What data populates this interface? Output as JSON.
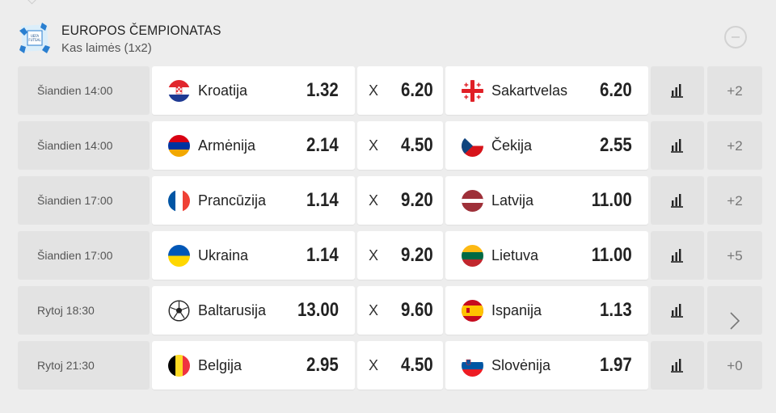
{
  "league": {
    "title": "EUROPOS ČEMPIONATAS",
    "market": "Kas laimės (1x2)",
    "logo_text": "FUTSAL"
  },
  "draw_symbol": "X",
  "matches": [
    {
      "time": "Šiandien 14:00",
      "home": "Kroatija",
      "home_flag": "croatia-flag-icon",
      "home_odd": "1.32",
      "draw_odd": "6.20",
      "away": "Sakartvelas",
      "away_flag": "georgia-flag-icon",
      "away_odd": "6.20",
      "more": "+2",
      "more_type": "count"
    },
    {
      "time": "Šiandien 14:00",
      "home": "Armėnija",
      "home_flag": "armenia-flag-icon",
      "home_odd": "2.14",
      "draw_odd": "4.50",
      "away": "Čekija",
      "away_flag": "czechia-flag-icon",
      "away_odd": "2.55",
      "more": "+2",
      "more_type": "count"
    },
    {
      "time": "Šiandien 17:00",
      "home": "Prancūzija",
      "home_flag": "france-flag-icon",
      "home_odd": "1.14",
      "draw_odd": "9.20",
      "away": "Latvija",
      "away_flag": "latvia-flag-icon",
      "away_odd": "11.00",
      "more": "+2",
      "more_type": "count"
    },
    {
      "time": "Šiandien 17:00",
      "home": "Ukraina",
      "home_flag": "ukraine-flag-icon",
      "home_odd": "1.14",
      "draw_odd": "9.20",
      "away": "Lietuva",
      "away_flag": "lithuania-flag-icon",
      "away_odd": "11.00",
      "more": "+5",
      "more_type": "count"
    },
    {
      "time": "Rytoj 18:30",
      "home": "Baltarusija",
      "home_flag": "football-icon",
      "home_odd": "13.00",
      "draw_odd": "9.60",
      "away": "Ispanija",
      "away_flag": "spain-flag-icon",
      "away_odd": "1.13",
      "more": "",
      "more_type": "chevron"
    },
    {
      "time": "Rytoj 21:30",
      "home": "Belgija",
      "home_flag": "belgium-flag-icon",
      "home_odd": "2.95",
      "draw_odd": "4.50",
      "away": "Slovėnija",
      "away_flag": "slovenia-flag-icon",
      "away_odd": "1.97",
      "more": "+0",
      "more_type": "count"
    }
  ],
  "colors": {
    "background": "#ededed",
    "card": "#ffffff",
    "muted_card": "#e3e3e3",
    "odd_text": "#222222"
  }
}
